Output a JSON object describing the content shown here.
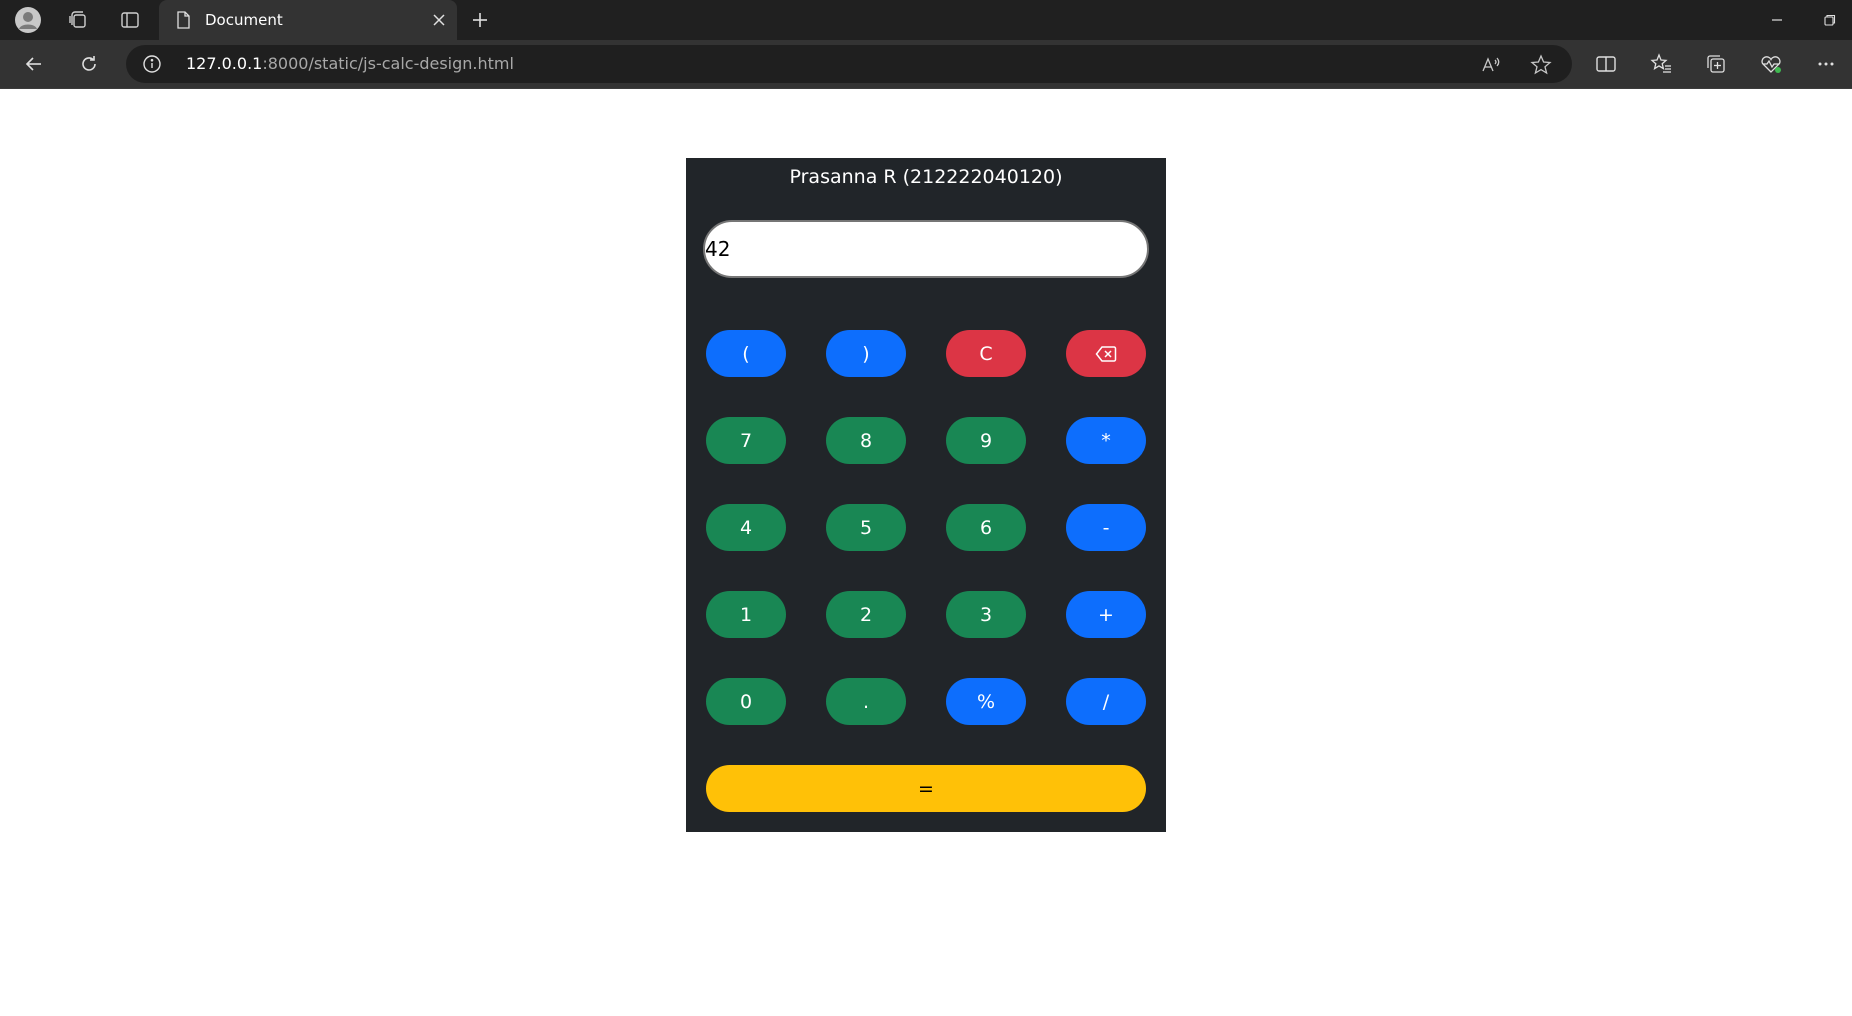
{
  "browser": {
    "tab_title": "Document",
    "url_host": "127.0.0.1",
    "url_rest": ":8000/static/js-calc-design.html"
  },
  "calculator": {
    "title": "Prasanna R (212222040120)",
    "display_value": "42",
    "keys": [
      {
        "label": "(",
        "color": "#0d6efd",
        "kind": "operator"
      },
      {
        "label": ")",
        "color": "#0d6efd",
        "kind": "operator"
      },
      {
        "label": "C",
        "color": "#dc3545",
        "kind": "clear"
      },
      {
        "label": "",
        "icon": "backspace-icon",
        "color": "#dc3545",
        "kind": "backspace"
      },
      {
        "label": "7",
        "color": "#198754",
        "kind": "digit"
      },
      {
        "label": "8",
        "color": "#198754",
        "kind": "digit"
      },
      {
        "label": "9",
        "color": "#198754",
        "kind": "digit"
      },
      {
        "label": "*",
        "color": "#0d6efd",
        "kind": "operator"
      },
      {
        "label": "4",
        "color": "#198754",
        "kind": "digit"
      },
      {
        "label": "5",
        "color": "#198754",
        "kind": "digit"
      },
      {
        "label": "6",
        "color": "#198754",
        "kind": "digit"
      },
      {
        "label": "-",
        "color": "#0d6efd",
        "kind": "operator"
      },
      {
        "label": "1",
        "color": "#198754",
        "kind": "digit"
      },
      {
        "label": "2",
        "color": "#198754",
        "kind": "digit"
      },
      {
        "label": "3",
        "color": "#198754",
        "kind": "digit"
      },
      {
        "label": "+",
        "color": "#0d6efd",
        "kind": "operator"
      },
      {
        "label": "0",
        "color": "#198754",
        "kind": "digit"
      },
      {
        "label": ".",
        "color": "#198754",
        "kind": "digit"
      },
      {
        "label": "%",
        "color": "#0d6efd",
        "kind": "operator"
      },
      {
        "label": "/",
        "color": "#0d6efd",
        "kind": "operator"
      }
    ],
    "equals_label": "=",
    "equals_color": "#ffc107"
  }
}
